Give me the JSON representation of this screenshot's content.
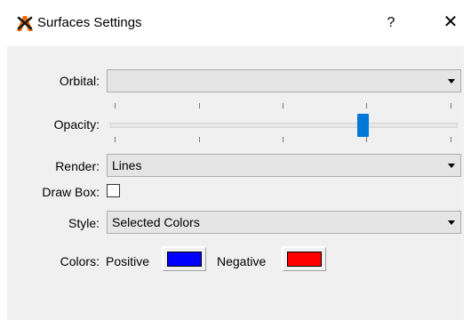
{
  "window": {
    "title": "Surfaces Settings",
    "help_label": "?",
    "close_label": "✕"
  },
  "form": {
    "orbital": {
      "label": "Orbital:",
      "value": ""
    },
    "opacity": {
      "label": "Opacity:",
      "level_fraction": 0.73
    },
    "render": {
      "label": "Render:",
      "value": "Lines"
    },
    "draw_box": {
      "label": "Draw Box:",
      "checked": false
    },
    "style": {
      "label": "Style:",
      "value": "Selected Colors"
    },
    "colors": {
      "label": "Colors:",
      "positive_label": "Positive",
      "positive_color": "#0000ff",
      "negative_label": "Negative",
      "negative_color": "#ff0000"
    }
  },
  "colors": {
    "accent": "#0078d7",
    "client_bg": "#f0f0f0",
    "control_bg": "#e5e5e5",
    "app_icon_orange": "#f06a00",
    "app_icon_dark": "#1a1a1a"
  }
}
